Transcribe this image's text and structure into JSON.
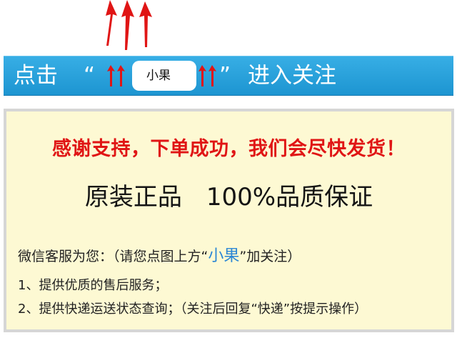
{
  "colors": {
    "arrow_red": "#e01515",
    "banner_blue": "#2ba3dd",
    "box_yellow": "#fdf9d3",
    "box_border": "#d6d6d6",
    "thanks_red": "#e01515",
    "service_blue": "#2a86d4"
  },
  "icons": {
    "top_arrows": "triple-up-arrows-icon",
    "banner_arrows": "double-up-arrows-icon"
  },
  "banner": {
    "left_text": "点击",
    "quote_open": "“",
    "account_name": "小果",
    "quote_close": "”",
    "right_text": "进入关注"
  },
  "info": {
    "thanks": "感谢支持，下单成功，我们会尽快发货！",
    "genuine": "原装正品　100%品质保证",
    "service_prefix": "微信客服为您：（请您点图上方“",
    "service_name": "小果",
    "service_suffix": "”加关注）",
    "item1": "1、提供优质的售后服务；",
    "item2": "2、提供快递运送状态查询；（关注后回复“快递”按提示操作）"
  }
}
